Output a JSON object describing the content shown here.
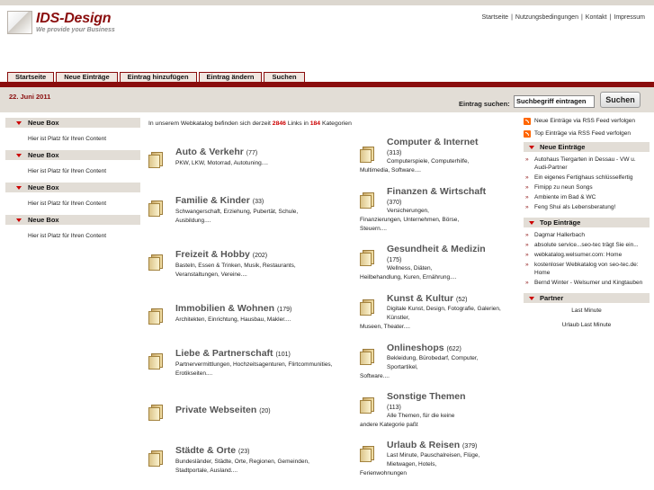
{
  "brand": {
    "title": "IDS-Design",
    "subtitle": "We provide your Business",
    "color": "#8a0d0d"
  },
  "toplinks": [
    "Startseite",
    "Nutzungsbedingungen",
    "Kontakt",
    "Impressum"
  ],
  "tabs": [
    "Startseite",
    "Neue Einträge",
    "Eintrag hinzufügen",
    "Eintrag ändern",
    "Suchen"
  ],
  "date": "22. Juni 2011",
  "search": {
    "label": "Eintrag suchen:",
    "value": "Suchbegriff eintragen",
    "button": "Suchen"
  },
  "left_boxes": [
    {
      "head": "Neue Box",
      "body": "Hier ist Platz für Ihren Content"
    },
    {
      "head": "Neue Box",
      "body": "Hier ist Platz für Ihren Content"
    },
    {
      "head": "Neue Box",
      "body": "Hier ist Platz für Ihren Content"
    },
    {
      "head": "Neue Box",
      "body": "Hier ist Platz für Ihren Content"
    }
  ],
  "intro": {
    "prefix": "In unserem Webkatalog befinden sich derzeit",
    "links": "2846",
    "middle": "Links in",
    "cats": "184",
    "suffix": "Kategorien"
  },
  "categories_left": [
    {
      "title": "Auto & Verkehr",
      "count": "(77)",
      "desc": "PKW, LKW, Motorrad, Autotuning...."
    },
    {
      "title": "Familie & Kinder",
      "count": "(33)",
      "desc": "Schwangerschaft, Erziehung, Pubertät, Schule, Ausbildung...."
    },
    {
      "title": "Freizeit & Hobby",
      "count": "(202)",
      "desc": "Basteln, Essen & Trinken, Musik, Restaurants, Veranstaltungen, Vereine...."
    },
    {
      "title": "Immobilien & Wohnen",
      "count": "(179)",
      "desc": "Architekten, Einrichtung, Hausbau, Makler...."
    },
    {
      "title": "Liebe & Partnerschaft",
      "count": "(101)",
      "desc": "Partnervermittlungen, Hochzeitsagenturen, Flirtcommunities, Erotikseiten...."
    },
    {
      "title": "Private Webseiten",
      "count": "(20)",
      "desc": ""
    },
    {
      "title": "Städte & Orte",
      "count": "(23)",
      "desc": "Bundesländer, Städte, Orte, Regionen, Gemeinden, Stadtportale, Ausland...."
    }
  ],
  "categories_right": [
    {
      "title": "Computer & Internet",
      "count": "(313)",
      "desc1": "Computerspiele, Computerhilfe,",
      "desc2": "Multimedia, Software...."
    },
    {
      "title": "Finanzen & Wirtschaft",
      "count": "(370)",
      "desc1": "Versicherungen,",
      "desc2": "Finanzierungen, Unternehmen, Börse, Steuern...."
    },
    {
      "title": "Gesundheit & Medizin",
      "count": "(175)",
      "desc1": "Wellness, Diäten,",
      "desc2": "Heilbehandlung, Kuren, Ernährung...."
    },
    {
      "title": "Kunst & Kultur",
      "count": "(52)",
      "desc1": "Digitale Kunst, Design, Fotografie, Galerien, Künstler,",
      "desc2": "Museen, Theater...."
    },
    {
      "title": "Onlineshops",
      "count": "(622)",
      "desc1": "Bekleidung, Bürobedarf, Computer, Sportartikel,",
      "desc2": "Software...."
    },
    {
      "title": "Sonstige Themen",
      "count": "(113)",
      "desc1": "Alle Themen, für die keine",
      "desc2": "andere Kategorie paßt"
    },
    {
      "title": "Urlaub & Reisen",
      "count": "(379)",
      "desc1": "Last Minute, Pauschalreisen, Flüge, Mietwagen, Hotels,",
      "desc2": "Ferienwohnungen"
    }
  ],
  "rss": [
    "Neue Einträge via RSS Feed verfolgen",
    "Top Einträge via RSS Feed verfolgen"
  ],
  "right_boxes": {
    "neue_head": "Neue Einträge",
    "neue": [
      "Autohaus Tiergarten in Dessau - VW u. Audi-Partner",
      "Ein eigenes Fertighaus schlüsselfertig",
      "Fimipp zu neun Songs",
      "Ambiente im Bad & WC",
      "Feng Shui als Lebensberatung!"
    ],
    "top_head": "Top Einträge",
    "top": [
      "Dagmar Hallerbach",
      "absolute service...seo-tec trägt Sie ein...",
      "webkatalog.welsumer.com: Home",
      "kostenloser Webkatalog von seo-tec.de: Home",
      "Bernd Winter - Welsumer und Kingtauben"
    ],
    "partner_head": "Partner",
    "partner": [
      "Last Minute",
      "Urlaub Last Minute"
    ]
  }
}
